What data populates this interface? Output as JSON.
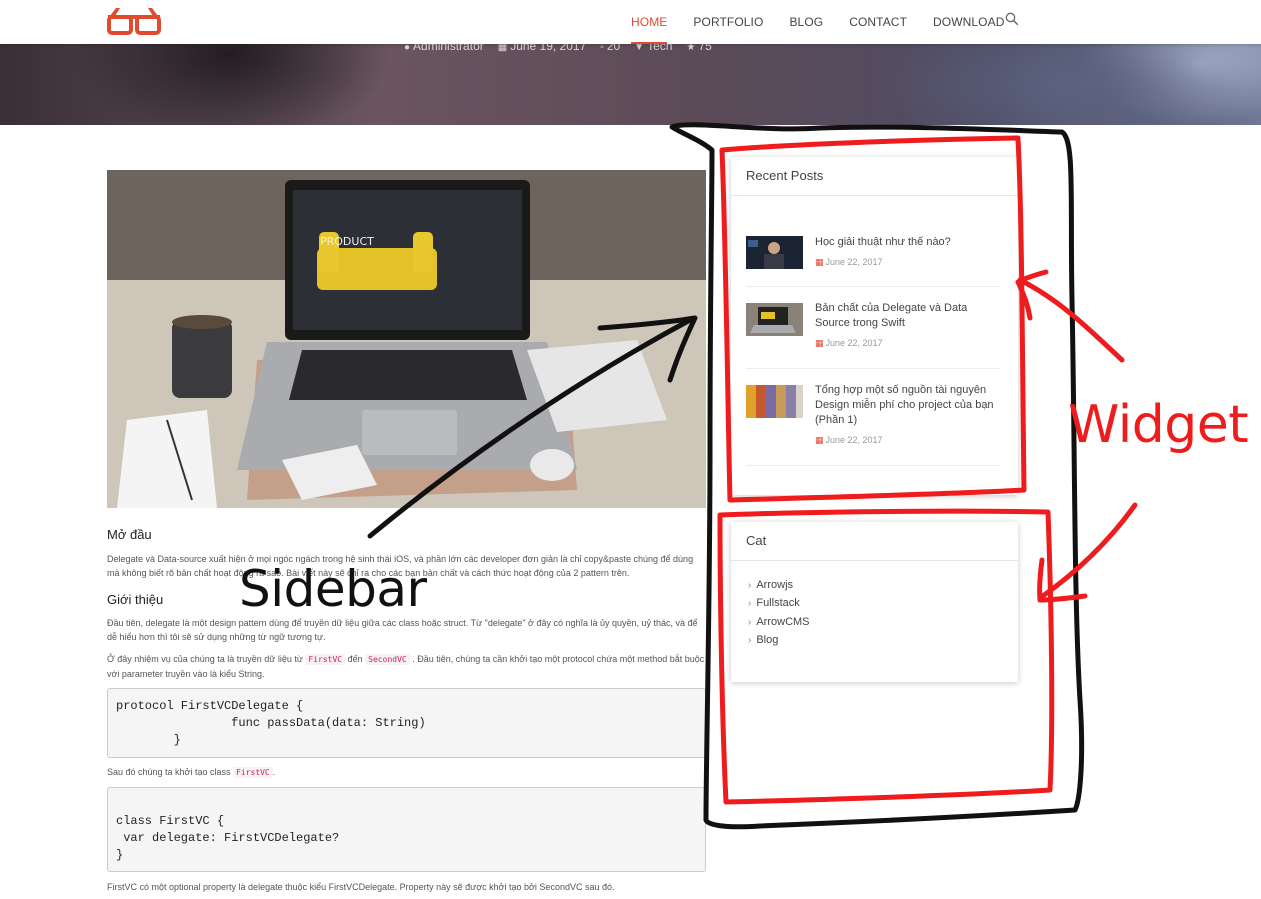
{
  "nav": {
    "items": [
      {
        "label": "HOME",
        "active": true
      },
      {
        "label": "PORTFOLIO",
        "active": false
      },
      {
        "label": "BLOG",
        "active": false
      },
      {
        "label": "CONTACT",
        "active": false
      },
      {
        "label": "DOWNLOAD",
        "active": false
      }
    ],
    "accent_color": "#e04a2f"
  },
  "hero": {
    "author": "Administrator",
    "date": "June 19, 2017",
    "comments": "20",
    "category": "Tech",
    "views": "75"
  },
  "article": {
    "image_text": "PRODUCT",
    "heading_intro": "Mở đầu",
    "para_intro": "Delegate và Data-source xuất hiện ở mọi ngóc ngách trong hệ sinh thái iOS, và phần lớn các developer đơn giản là chỉ copy&paste chúng để dùng mà không biết rõ bản chất hoạt động ra sao. Bài viết này sẽ chỉ ra cho các bạn bản chất và cách thức hoạt động của 2 pattern trên.",
    "heading_about": "Giới thiệu",
    "para_about": "Đầu tiên, delegate là một design pattern dùng để truyền dữ liệu giữa các class hoặc struct. Từ \"delegate\" ở đây có nghĩa là ủy quyền, uỷ thác, và để dễ hiểu hơn thì tôi sẽ sử dụng những từ ngữ tương tự.",
    "para_task_pre": "Ở đây nhiệm vụ của chúng ta là truyền dữ liệu từ",
    "para_task_code1": "FirstVC",
    "para_task_mid": "đến",
    "para_task_code2": "SecondVC",
    "para_task_post": ". Đầu tiên, chúng ta cần khởi tạo một protocol chứa một method bắt buộc với parameter truyền vào là kiểu String.",
    "code1": [
      "protocol FirstVCDelegate {",
      "                func passData(data: String)",
      "        }"
    ],
    "para_then_pre": "Sau đó chúng ta khởi tạo class",
    "para_then_code": "FirstVC",
    "para_then_post": ".",
    "code2": [
      "class FirstVC {",
      " var delegate: FirstVCDelegate?",
      "}"
    ],
    "para_last": "FirstVC có một optional property là delegate thuộc kiểu FirstVCDelegate. Property này sẽ được khởi tạo bởi SecondVC sau đó."
  },
  "recent_posts": {
    "title": "Recent Posts",
    "items": [
      {
        "title": "Học giải thuật như thế nào?",
        "date": "June 22, 2017"
      },
      {
        "title": "Bản chất của Delegate và Data Source trong Swift",
        "date": "June 22, 2017"
      },
      {
        "title": "Tổng hợp một số nguồn tài nguyên Design miễn phí cho project của bạn (Phần 1)",
        "date": "June 22, 2017"
      }
    ]
  },
  "categories": {
    "title": "Cat",
    "items": [
      "Arrowjs",
      "Fullstack",
      "ArrowCMS",
      "Blog"
    ]
  },
  "annotations": {
    "sidebar_label": "Sidebar",
    "widget_label": "Widget",
    "ink_black": "#111111",
    "ink_red": "#ee1c1c"
  },
  "icons": {
    "logo": "glasses-logo",
    "search": "search-icon",
    "calendar": "calendar-icon",
    "chevron": "chevron-right-icon"
  }
}
